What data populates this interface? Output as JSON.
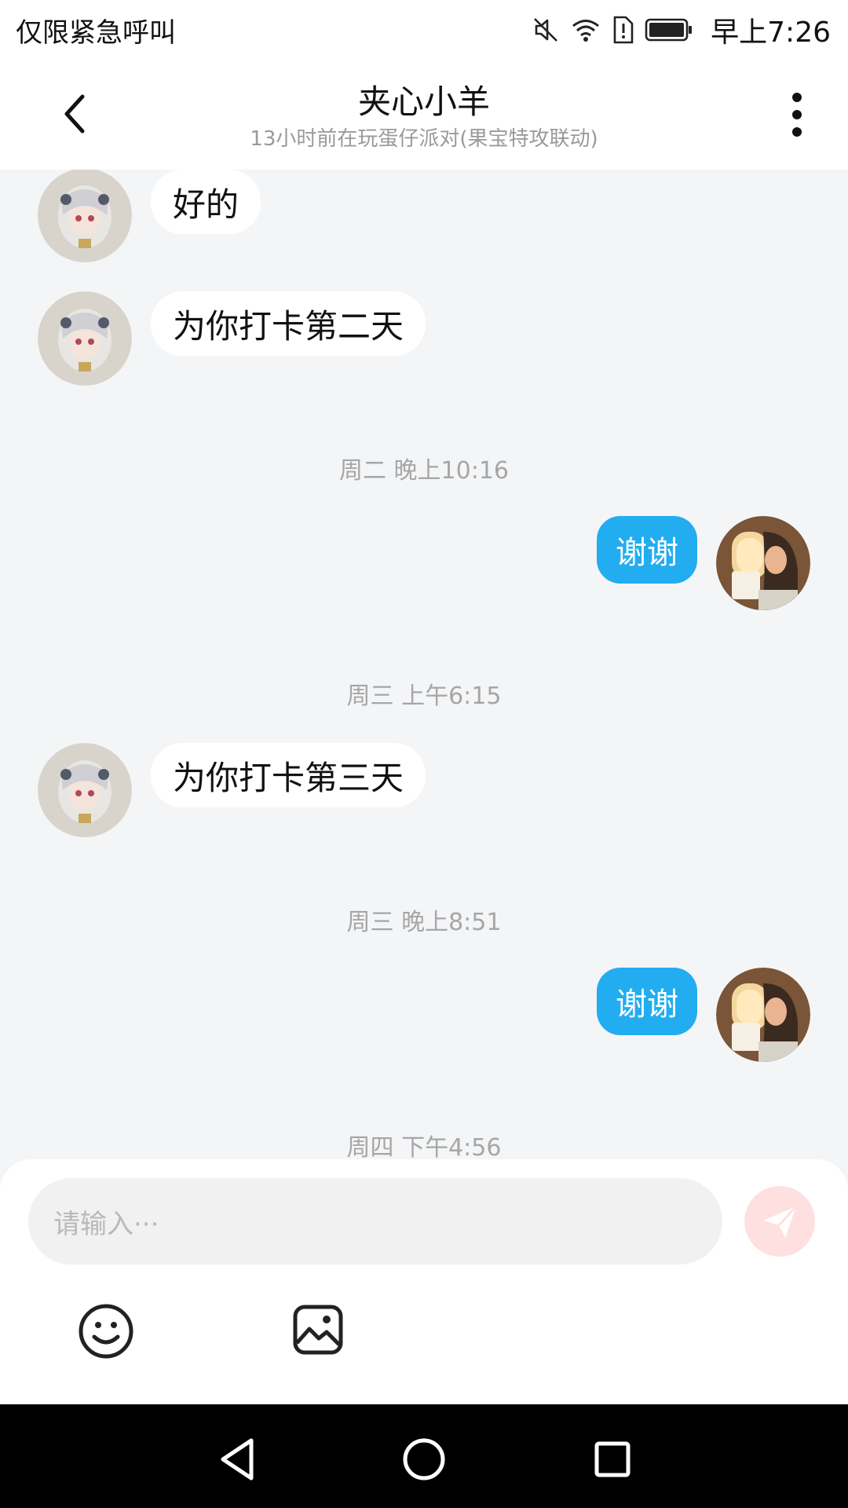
{
  "status_bar": {
    "carrier": "仅限紧急呼叫",
    "time": "早上7:26",
    "icons": [
      "mute-icon",
      "wifi-icon",
      "sim-alert-icon",
      "battery-icon"
    ]
  },
  "header": {
    "name": "夹心小羊",
    "status": "13小时前在玩蛋仔派对(果宝特攻联动)",
    "back_icon": "chevron-left-icon",
    "more_icon": "more-vertical-icon"
  },
  "messages": [
    {
      "type": "in",
      "text": "好的"
    },
    {
      "type": "in",
      "text": "为你打卡第二天"
    },
    {
      "type": "time",
      "text": "周二 晚上10:16"
    },
    {
      "type": "out",
      "text": "谢谢"
    },
    {
      "type": "time",
      "text": "周三 上午6:15"
    },
    {
      "type": "in",
      "text": "为你打卡第三天"
    },
    {
      "type": "time",
      "text": "周三 晚上8:51"
    },
    {
      "type": "out",
      "text": "谢谢"
    },
    {
      "type": "time",
      "text": "周四 下午4:56"
    }
  ],
  "composer": {
    "placeholder": "请输入···",
    "send_icon": "send-icon",
    "emoji_icon": "smiley-icon",
    "image_icon": "image-icon"
  },
  "colors": {
    "accent": "#22adf0",
    "background": "#f4f5f7",
    "send_disabled": "#ffe0e0"
  },
  "nav_bar": {
    "icons": [
      "back-triangle-icon",
      "home-circle-icon",
      "recents-square-icon"
    ]
  }
}
